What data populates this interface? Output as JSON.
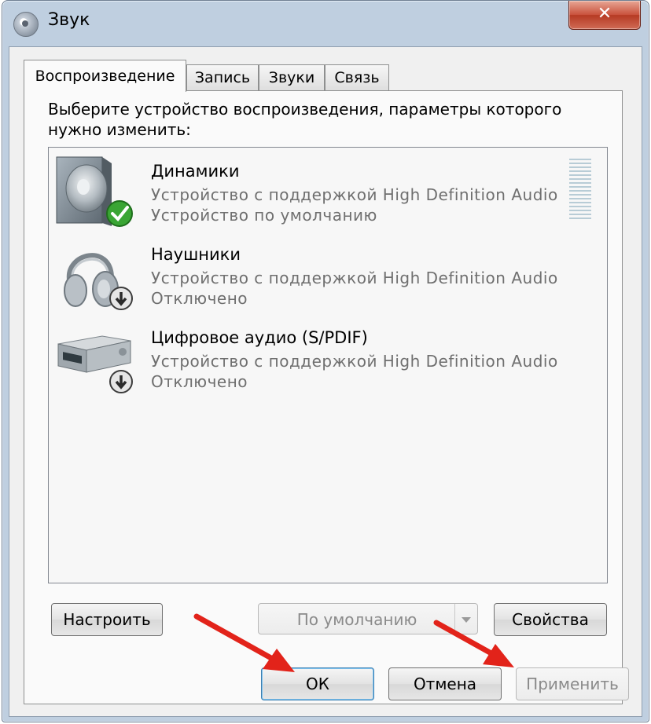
{
  "window": {
    "title": "Звук",
    "close_glyph": "✕"
  },
  "tabs": [
    {
      "label": "Воспроизведение",
      "active": true
    },
    {
      "label": "Запись",
      "active": false
    },
    {
      "label": "Звуки",
      "active": false
    },
    {
      "label": "Связь",
      "active": false
    }
  ],
  "instruction": "Выберите устройство воспроизведения, параметры которого нужно изменить:",
  "devices": [
    {
      "name": "Динамики",
      "description": "Устройство с поддержкой High Definition Audio",
      "status": "Устройство по умолчанию",
      "icon": "speaker-icon",
      "badge": "default-checkmark-icon"
    },
    {
      "name": "Наушники",
      "description": "Устройство с поддержкой High Definition Audio",
      "status": "Отключено",
      "icon": "headphones-icon",
      "badge": "disabled-arrow-icon"
    },
    {
      "name": "Цифровое аудио (S/PDIF)",
      "description": "Устройство с поддержкой High Definition Audio",
      "status": "Отключено",
      "icon": "digital-audio-receiver-icon",
      "badge": "disabled-arrow-icon"
    }
  ],
  "buttons": {
    "configure": "Настроить",
    "set_default": "По умолчанию",
    "properties": "Свойства",
    "ok": "ОК",
    "cancel": "Отмена",
    "apply": "Применить"
  },
  "colors": {
    "annotation_arrow": "#e2231a",
    "default_check": "#3aa534"
  }
}
